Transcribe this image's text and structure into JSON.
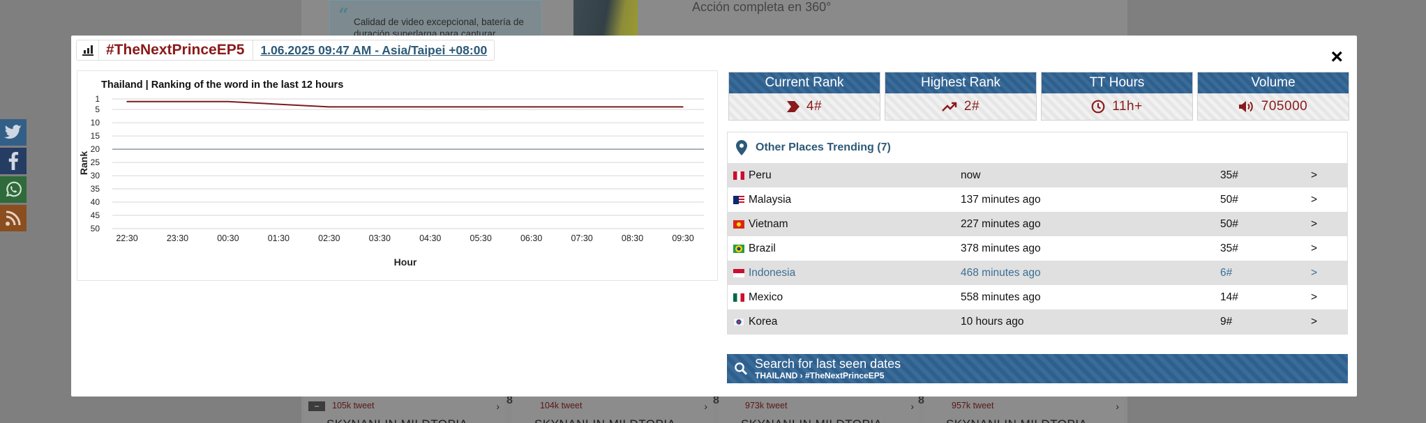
{
  "background": {
    "promo_text": "Calidad de video excepcional, batería de duración superlarga para capturar",
    "right_text": "Acción completa en 360°",
    "cards": [
      {
        "tweet": "105k tweet",
        "title": "SKYNANI IN MILDTOPIA",
        "num": ""
      },
      {
        "tweet": "104k tweet",
        "title": "SKYNANI IN MILDTOPIA",
        "num": "8"
      },
      {
        "tweet": "973k tweet",
        "title": "SKYNANI IN MILDTOPIA",
        "num": "8"
      },
      {
        "tweet": "957k tweet",
        "title": "SKYNANI IN MILDTOPIA",
        "num": "8"
      }
    ]
  },
  "social": [
    "twitter-icon",
    "facebook-icon",
    "whatsapp-icon",
    "rss-icon"
  ],
  "modal": {
    "hashtag": "#TheNextPrinceEP5",
    "datetime": "1.06.2025 09:47 AM - Asia/Taipei +08:00",
    "close": "×"
  },
  "chart_data": {
    "type": "line",
    "title": "Thailand | Ranking of the word in the last 12 hours",
    "xlabel": "Hour",
    "ylabel": "Rank",
    "categories": [
      "22:30",
      "23:30",
      "00:30",
      "01:30",
      "02:30",
      "03:30",
      "04:30",
      "05:30",
      "06:30",
      "07:30",
      "08:30",
      "09:30"
    ],
    "yticks": [
      1,
      5,
      10,
      15,
      20,
      25,
      30,
      35,
      40,
      45,
      50
    ],
    "ylim": [
      1,
      50
    ],
    "y_inverted": true,
    "grid": true,
    "series": [
      {
        "values": [
          2,
          2,
          2,
          3,
          4,
          4,
          4,
          4,
          4,
          4,
          4,
          4
        ],
        "color": "#7a1c1c"
      }
    ],
    "reference_line": {
      "y": 20,
      "color": "#8a9aa6"
    }
  },
  "stats": [
    {
      "title": "Current Rank",
      "value": "4#",
      "icon": "chevron-icon"
    },
    {
      "title": "Highest Rank",
      "value": "2#",
      "icon": "trend-up-icon"
    },
    {
      "title": "TT Hours",
      "value": "11h+",
      "icon": "clock-icon"
    },
    {
      "title": "Volume",
      "value": "705000",
      "icon": "speaker-icon"
    }
  ],
  "places": {
    "header": "Other Places Trending (7)",
    "rows": [
      {
        "country": "Peru",
        "time": "now",
        "rank": "35#",
        "go": ">",
        "flag": "peru"
      },
      {
        "country": "Malaysia",
        "time": "137 minutes ago",
        "rank": "50#",
        "go": ">",
        "flag": "malaysia"
      },
      {
        "country": "Vietnam",
        "time": "227 minutes ago",
        "rank": "50#",
        "go": ">",
        "flag": "vietnam"
      },
      {
        "country": "Brazil",
        "time": "378 minutes ago",
        "rank": "35#",
        "go": ">",
        "flag": "brazil"
      },
      {
        "country": "Indonesia",
        "time": "468 minutes ago",
        "rank": "6#",
        "go": ">",
        "flag": "indonesia",
        "highlighted": true
      },
      {
        "country": "Mexico",
        "time": "558 minutes ago",
        "rank": "14#",
        "go": ">",
        "flag": "mexico"
      },
      {
        "country": "Korea",
        "time": "10 hours ago",
        "rank": "9#",
        "go": ">",
        "flag": "korea"
      }
    ]
  },
  "search": {
    "title": "Search for last seen dates",
    "subtitle": "THAILAND › #TheNextPrinceEP5"
  },
  "colors": {
    "accent_blue": "#2f5f8d",
    "brand_red": "#8b1a1a",
    "link_blue": "#2c5a78"
  }
}
